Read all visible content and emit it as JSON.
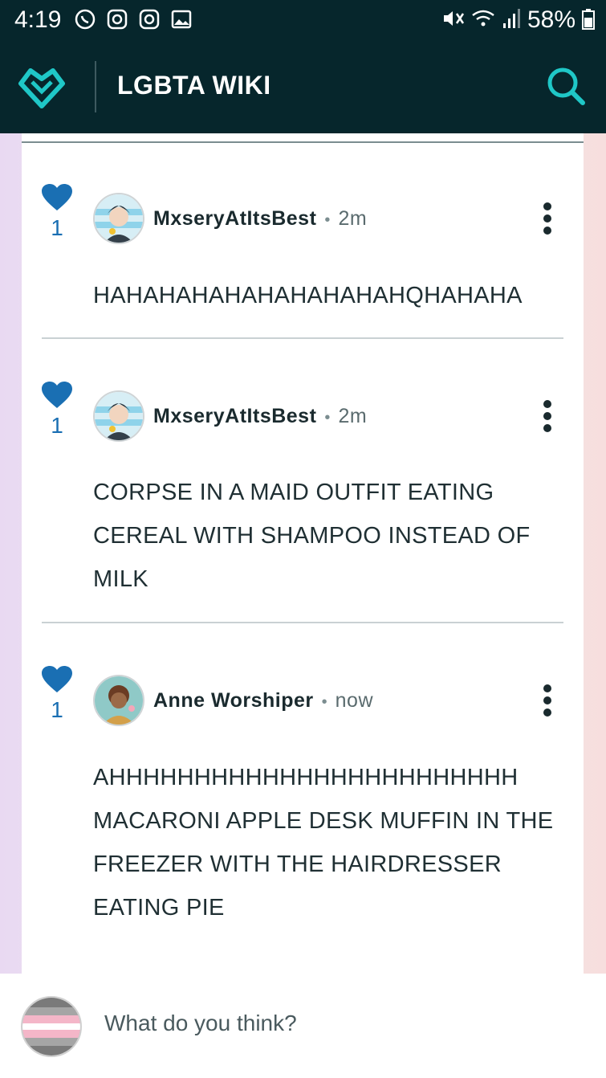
{
  "status_bar": {
    "time": "4:19",
    "battery": "58%"
  },
  "app": {
    "title": "LGBTA WIKI",
    "logo": "heart-logo-icon",
    "search_icon": "search-icon"
  },
  "comments": [
    {
      "likes": "1",
      "user": "MxseryAtItsBest",
      "time": "2m",
      "text": "HAHAHAHAHAHAHAHAHAHQHAHAHA"
    },
    {
      "likes": "1",
      "user": "MxseryAtItsBest",
      "time": "2m",
      "text": "CORPSE IN A MAID OUTFIT EATING CEREAL WITH SHAMPOO INSTEAD OF MILK"
    },
    {
      "likes": "1",
      "user": "Anne Worshiper",
      "time": "now",
      "text": "AHHHHHHHHHHHHHHHHHHHHHHHH MACARONI APPLE DESK MUFFIN IN THE FREEZER WITH THE HAIRDRESSER EATING PIE"
    }
  ],
  "composer": {
    "placeholder": "What do you think?"
  },
  "colors": {
    "header_bg": "#06262c",
    "accent": "#1fc7c7",
    "like": "#1a6fb3"
  }
}
